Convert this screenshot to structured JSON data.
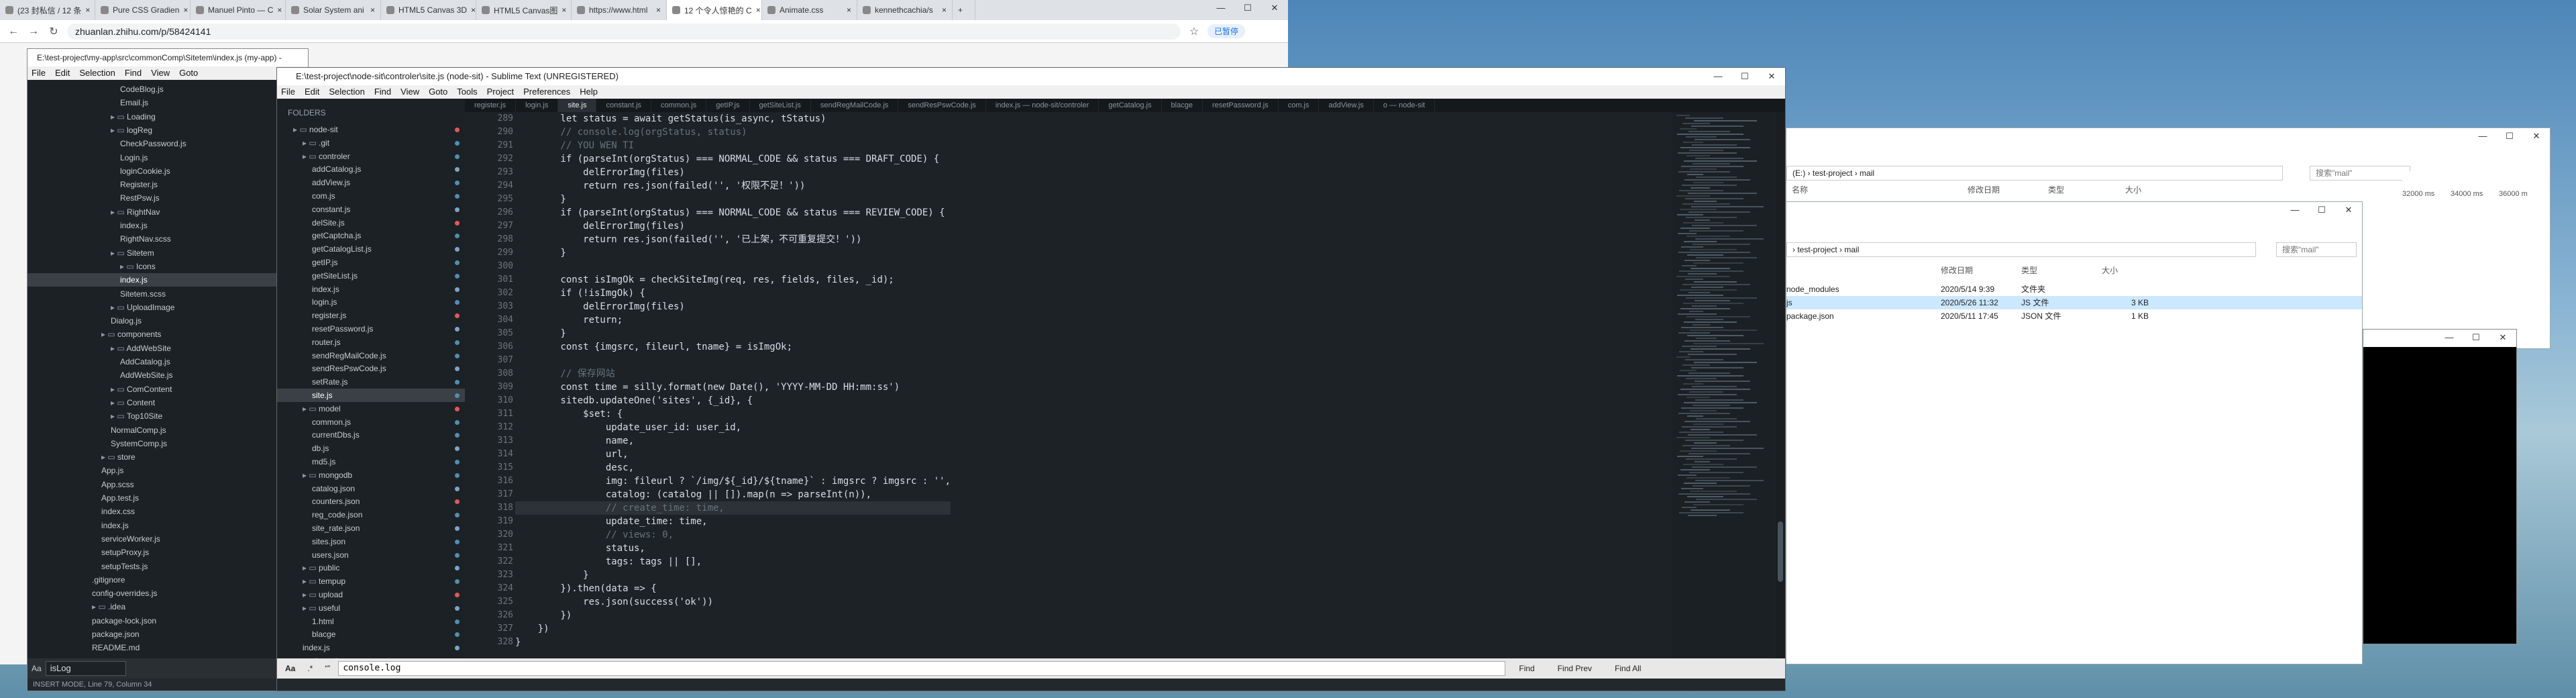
{
  "browser": {
    "tabs": [
      {
        "label": "(23 封私信 / 12 条"
      },
      {
        "label": "Pure CSS Gradien"
      },
      {
        "label": "Manuel Pinto — C"
      },
      {
        "label": "Solar System ani"
      },
      {
        "label": "HTML5 Canvas 3D"
      },
      {
        "label": "HTML5 Canvas图"
      },
      {
        "label": "https://www.html"
      },
      {
        "label": "12 个令人惊艳的 C"
      },
      {
        "label": "Animate.css"
      },
      {
        "label": "kennethcachia/s"
      }
    ],
    "active_tab": 7,
    "url": "zhuanlan.zhihu.com/p/58424141",
    "paused_label": "已暂停"
  },
  "editor_back": {
    "title": "E:\\test-project\\my-app\\src\\commonComp\\Sitetem\\index.js (my-app) - Sublime Text (UNREGISTERED)",
    "menu": [
      "File",
      "Edit",
      "Selection",
      "Find",
      "View",
      "Goto"
    ],
    "tree": [
      {
        "label": "CodeBlog.js",
        "indent": 2
      },
      {
        "label": "Email.js",
        "indent": 2
      },
      {
        "label": "Loading",
        "indent": 1,
        "folder": true
      },
      {
        "label": "logReg",
        "indent": 1,
        "folder": true
      },
      {
        "label": "CheckPassword.js",
        "indent": 2
      },
      {
        "label": "Login.js",
        "indent": 2
      },
      {
        "label": "loginCookie.js",
        "indent": 2
      },
      {
        "label": "Register.js",
        "indent": 2
      },
      {
        "label": "RestPsw.js",
        "indent": 2
      },
      {
        "label": "RightNav",
        "indent": 1,
        "folder": true
      },
      {
        "label": "index.js",
        "indent": 2
      },
      {
        "label": "RightNav.scss",
        "indent": 2
      },
      {
        "label": "Sitetem",
        "indent": 1,
        "folder": true
      },
      {
        "label": "Icons",
        "indent": 2,
        "folder": true
      },
      {
        "label": "index.js",
        "indent": 2,
        "selected": true
      },
      {
        "label": "Sitetem.scss",
        "indent": 2
      },
      {
        "label": "UploadImage",
        "indent": 1,
        "folder": true
      },
      {
        "label": "Dialog.js",
        "indent": 1
      },
      {
        "label": "components",
        "indent": 0,
        "folder": true
      },
      {
        "label": "AddWebSite",
        "indent": 1,
        "folder": true
      },
      {
        "label": "AddCatalog.js",
        "indent": 2
      },
      {
        "label": "AddWebSite.js",
        "indent": 2
      },
      {
        "label": "ComContent",
        "indent": 1,
        "folder": true
      },
      {
        "label": "Content",
        "indent": 1,
        "folder": true
      },
      {
        "label": "Top10Site",
        "indent": 1,
        "folder": true
      },
      {
        "label": "NormalComp.js",
        "indent": 1
      },
      {
        "label": "SystemComp.js",
        "indent": 1
      },
      {
        "label": "store",
        "indent": 0,
        "folder": true
      },
      {
        "label": "App.js",
        "indent": 0
      },
      {
        "label": "App.scss",
        "indent": 0
      },
      {
        "label": "App.test.js",
        "indent": 0
      },
      {
        "label": "index.css",
        "indent": 0
      },
      {
        "label": "index.js",
        "indent": 0
      },
      {
        "label": "serviceWorker.js",
        "indent": 0
      },
      {
        "label": "setupProxy.js",
        "indent": 0
      },
      {
        "label": "setupTests.js",
        "indent": 0
      },
      {
        "label": ".gitignore",
        "indent": -1
      },
      {
        "label": "config-overrides.js",
        "indent": -1
      },
      {
        "label": ".idea",
        "indent": -1,
        "folder": true
      },
      {
        "label": "package-lock.json",
        "indent": -1
      },
      {
        "label": "package.json",
        "indent": -1
      },
      {
        "label": "README.md",
        "indent": -1
      }
    ],
    "status": "INSERT MODE, Line 79, Column 34",
    "find_hint": "isLog"
  },
  "editor": {
    "title": "E:\\test-project\\node-sit\\controler\\site.js (node-sit) - Sublime Text (UNREGISTERED)",
    "menu": [
      "File",
      "Edit",
      "Selection",
      "Find",
      "View",
      "Goto",
      "Tools",
      "Project",
      "Preferences",
      "Help"
    ],
    "folders_label": "FOLDERS",
    "tree": [
      {
        "label": "node-sit",
        "indent": 0,
        "folder": true
      },
      {
        "label": ".git",
        "indent": 1,
        "folder": true
      },
      {
        "label": "controler",
        "indent": 1,
        "folder": true
      },
      {
        "label": "addCatalog.js",
        "indent": 2
      },
      {
        "label": "addView.js",
        "indent": 2
      },
      {
        "label": "com.js",
        "indent": 2
      },
      {
        "label": "constant.js",
        "indent": 2
      },
      {
        "label": "delSite.js",
        "indent": 2
      },
      {
        "label": "getCaptcha.js",
        "indent": 2
      },
      {
        "label": "getCatalogList.js",
        "indent": 2
      },
      {
        "label": "getIP.js",
        "indent": 2
      },
      {
        "label": "getSiteList.js",
        "indent": 2
      },
      {
        "label": "index.js",
        "indent": 2
      },
      {
        "label": "login.js",
        "indent": 2
      },
      {
        "label": "register.js",
        "indent": 2
      },
      {
        "label": "resetPassword.js",
        "indent": 2
      },
      {
        "label": "router.js",
        "indent": 2
      },
      {
        "label": "sendRegMailCode.js",
        "indent": 2
      },
      {
        "label": "sendResPswCode.js",
        "indent": 2
      },
      {
        "label": "setRate.js",
        "indent": 2
      },
      {
        "label": "site.js",
        "indent": 2,
        "selected": true
      },
      {
        "label": "model",
        "indent": 1,
        "folder": true
      },
      {
        "label": "common.js",
        "indent": 2
      },
      {
        "label": "currentDbs.js",
        "indent": 2
      },
      {
        "label": "db.js",
        "indent": 2
      },
      {
        "label": "md5.js",
        "indent": 2
      },
      {
        "label": "mongodb",
        "indent": 1,
        "folder": true
      },
      {
        "label": "catalog.json",
        "indent": 2
      },
      {
        "label": "counters.json",
        "indent": 2
      },
      {
        "label": "reg_code.json",
        "indent": 2
      },
      {
        "label": "site_rate.json",
        "indent": 2
      },
      {
        "label": "sites.json",
        "indent": 2
      },
      {
        "label": "users.json",
        "indent": 2
      },
      {
        "label": "public",
        "indent": 1,
        "folder": true
      },
      {
        "label": "tempup",
        "indent": 1,
        "folder": true
      },
      {
        "label": "upload",
        "indent": 1,
        "folder": true
      },
      {
        "label": "useful",
        "indent": 1,
        "folder": true
      },
      {
        "label": "1.html",
        "indent": 2
      },
      {
        "label": "blacge",
        "indent": 2
      },
      {
        "label": "index.js",
        "indent": 1
      },
      {
        "label": "package.json",
        "indent": 1
      }
    ],
    "file_tabs": [
      "register.js",
      "login.js",
      "site.js",
      "constant.js",
      "common.js",
      "getIP.js",
      "getSiteList.js",
      "sendRegMailCode.js",
      "sendResPswCode.js",
      "index.js — node-sit/controler",
      "getCatalog.js",
      "blacge",
      "resetPassword.js",
      "com.js",
      "addView.js",
      "o — node-sit"
    ],
    "active_file_tab": 2,
    "line_numbers": [
      "289",
      "290",
      "291",
      "292",
      "293",
      "294",
      "295",
      "296",
      "297",
      "298",
      "299",
      "300",
      "301",
      "302",
      "303",
      "304",
      "305",
      "306",
      "307",
      "308",
      "309",
      "310",
      "311",
      "312",
      "313",
      "314",
      "315",
      "316",
      "317",
      "318",
      "319",
      "320",
      "321",
      "322",
      "323",
      "324",
      "325",
      "326",
      "327",
      "328"
    ],
    "code_lines": [
      "        let status = await getStatus(is_async, tStatus)",
      "        // console.log(orgStatus, status)",
      "        // YOU WEN TI",
      "        if (parseInt(orgStatus) === NORMAL_CODE && status === DRAFT_CODE) {",
      "            delErrorImg(files)",
      "            return res.json(failed('', '权限不足！'))",
      "        }",
      "        if (parseInt(orgStatus) === NORMAL_CODE && status === REVIEW_CODE) {",
      "            delErrorImg(files)",
      "            return res.json(failed('', '已上架，不可重复提交！'))",
      "        }",
      "",
      "        const isImgOk = checkSiteImg(req, res, fields, files, _id);",
      "        if (!isImgOk) {",
      "            delErrorImg(files)",
      "            return;",
      "        }",
      "        const {imgsrc, fileurl, tname} = isImgOk;",
      "",
      "        // 保存网站",
      "        const time = silly.format(new Date(), 'YYYY-MM-DD HH:mm:ss')",
      "        sitedb.updateOne('sites', {_id}, {",
      "            $set: {",
      "                update_user_id: user_id,",
      "                name,",
      "                url,",
      "                desc,",
      "                img: fileurl ? `/img/${_id}/${tname}` : imgsrc ? imgsrc : '',",
      "                catalog: (catalog || []).map(n => parseInt(n)),",
      "                // create_time: time,",
      "                update_time: time,",
      "                // views: 0,",
      "                status,",
      "                tags: tags || [],",
      "            }",
      "        }).then(data => {",
      "            res.json(success('ok'))",
      "        })",
      "    })",
      "}"
    ],
    "find_value": "console.log",
    "find_buttons": [
      "Find",
      "Find Prev",
      "Find All"
    ],
    "find_toggle": "Aa"
  },
  "explorer_back": {
    "path_segments": [
      "(E:)",
      "test-project",
      "mail"
    ],
    "search_placeholder": "搜索\"mail\"",
    "columns": [
      "名称",
      "修改日期",
      "类型",
      "大小"
    ],
    "timeline": [
      "32000 ms",
      "34000 ms",
      "36000 m"
    ]
  },
  "explorer": {
    "path_segments": [
      "test-project",
      "mail"
    ],
    "search_placeholder": "搜索\"mail\"",
    "columns": [
      "修改日期",
      "类型",
      "大小"
    ],
    "rows": [
      {
        "name": "node_modules",
        "date": "2020/5/14 9:39",
        "type": "文件夹",
        "size": ""
      },
      {
        "name": "js",
        "date": "2020/5/26 11:32",
        "type": "JS 文件",
        "size": "3 KB"
      },
      {
        "name": "package.json",
        "date": "2020/5/11 17:45",
        "type": "JSON 文件",
        "size": "1 KB"
      }
    ]
  },
  "colors": {
    "editor_bg": "#1d2226",
    "accent": "#0078d7"
  }
}
